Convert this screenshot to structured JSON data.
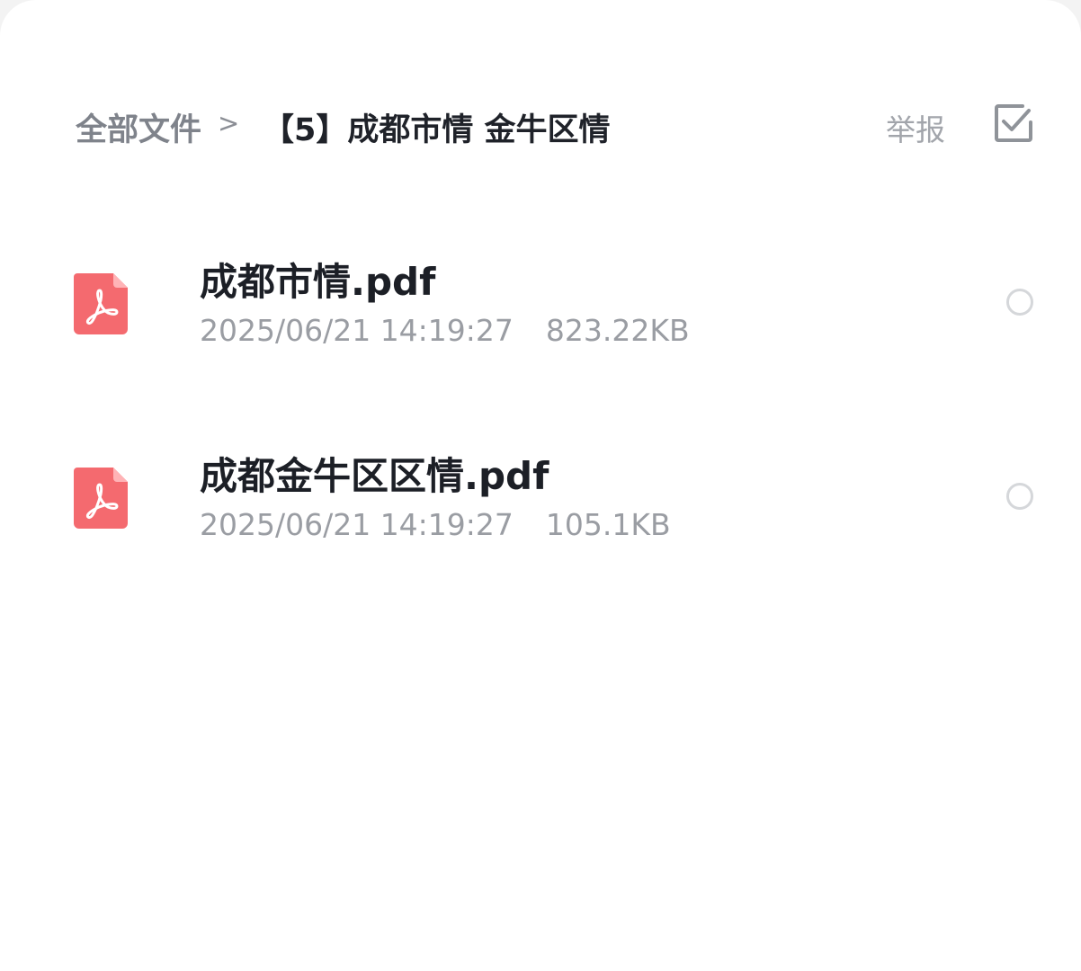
{
  "header": {
    "breadcrumb_root": "全部文件",
    "breadcrumb_separator": ">",
    "current_folder": "【5】成都市情 金牛区情",
    "report_label": "举报",
    "select_icon": "checkbox-select-icon"
  },
  "files": [
    {
      "name": "成都市情.pdf",
      "date": "2025/06/21 14:19:27",
      "size": "823.22KB",
      "icon": "pdf-icon",
      "selected": false
    },
    {
      "name": "成都金牛区区情.pdf",
      "date": "2025/06/21 14:19:27",
      "size": "105.1KB",
      "icon": "pdf-icon",
      "selected": false
    }
  ],
  "colors": {
    "pdf_icon": "#f46a6f",
    "title_text": "#1c1f26",
    "muted_text": "#9a9da3"
  }
}
